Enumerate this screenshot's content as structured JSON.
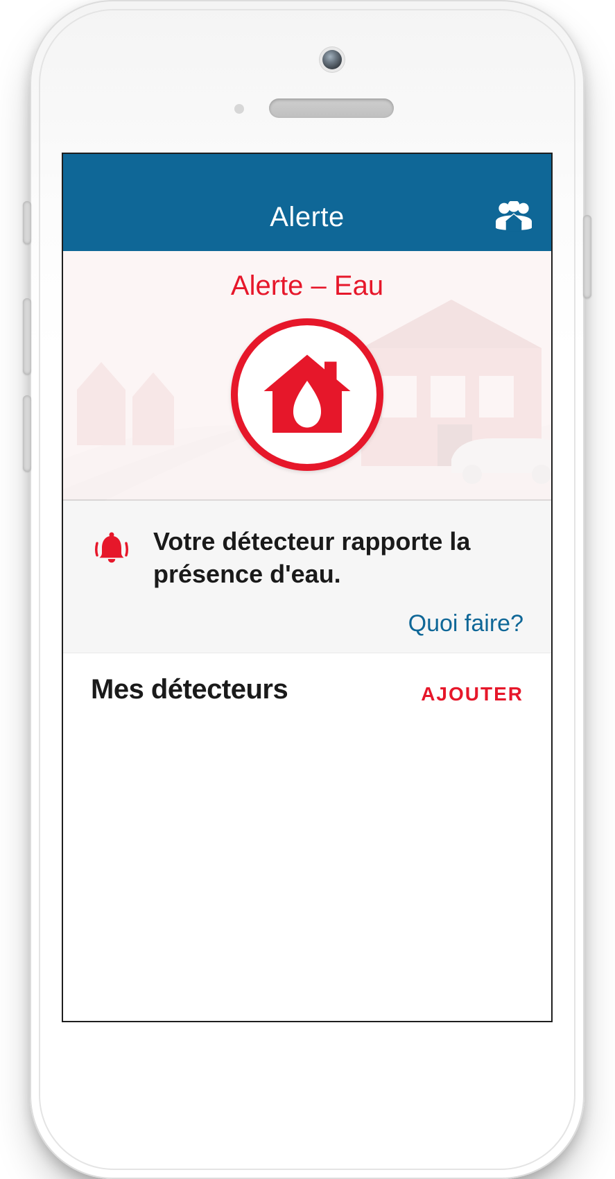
{
  "header": {
    "title": "Alerte"
  },
  "hero": {
    "title": "Alerte – Eau"
  },
  "alert": {
    "message": "Votre détecteur rapporte la présence d'eau.",
    "help_link": "Quoi faire?"
  },
  "section": {
    "title": "Mes détecteurs",
    "add_label": "AJOUTER"
  },
  "colors": {
    "brand_blue": "#0f6797",
    "alert_red": "#e6172a"
  }
}
